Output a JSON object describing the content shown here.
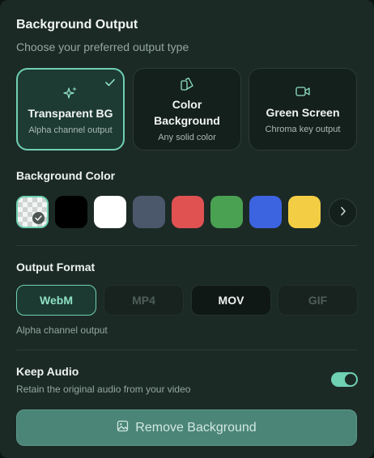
{
  "header": {
    "title": "Background Output",
    "subtitle": "Choose your preferred output type"
  },
  "output_types": [
    {
      "name": "Transparent BG",
      "description": "Alpha channel output",
      "icon": "sparkles-icon",
      "selected": true
    },
    {
      "name_line1": "Color",
      "name_line2": "Background",
      "description": "Any solid color",
      "icon": "palette-icon",
      "selected": false
    },
    {
      "name": "Green Screen",
      "description": "Chroma key output",
      "icon": "video-camera-icon",
      "selected": false
    }
  ],
  "background_color": {
    "label": "Background Color",
    "swatches": [
      {
        "name": "transparent",
        "color": "checkerboard",
        "selected": true
      },
      {
        "name": "black",
        "color": "#000000"
      },
      {
        "name": "white",
        "color": "#ffffff"
      },
      {
        "name": "slate",
        "color": "#4b586c"
      },
      {
        "name": "red",
        "color": "#e05252"
      },
      {
        "name": "green",
        "color": "#4aa152"
      },
      {
        "name": "blue",
        "color": "#3c63e0"
      },
      {
        "name": "yellow",
        "color": "#f3ce45"
      }
    ]
  },
  "output_format": {
    "label": "Output Format",
    "options": [
      {
        "label": "WebM",
        "state": "active"
      },
      {
        "label": "MP4",
        "state": "disabled"
      },
      {
        "label": "MOV",
        "state": "normal"
      },
      {
        "label": "GIF",
        "state": "disabled"
      }
    ],
    "hint": "Alpha channel output"
  },
  "audio": {
    "label": "Keep Audio",
    "description": "Retain the original audio from your video",
    "enabled": true
  },
  "action": {
    "label": "Remove Background",
    "icon": "image-icon"
  },
  "colors": {
    "accent": "#6fd0b2",
    "panel": "#1c2a26",
    "button": "#4b8577"
  }
}
